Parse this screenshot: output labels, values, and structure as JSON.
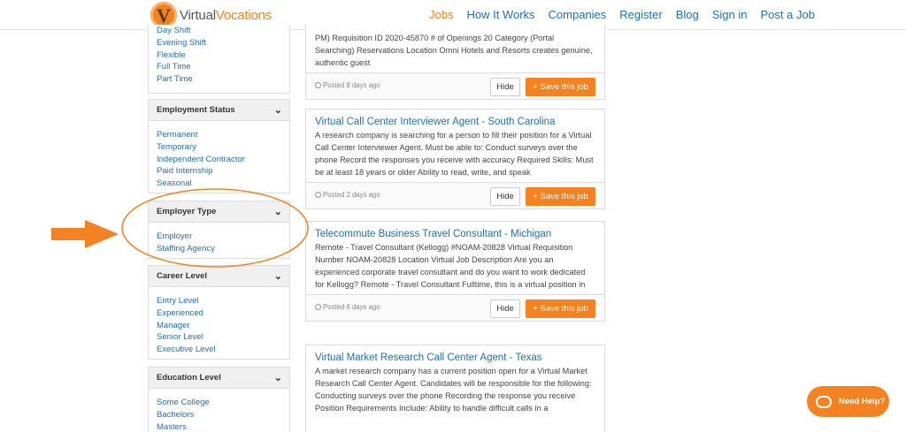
{
  "header": {
    "logo": {
      "mark": "V",
      "word1": "Virtual",
      "word2": "Vocations"
    },
    "nav": [
      "Jobs",
      "How It Works",
      "Companies",
      "Register",
      "Blog",
      "Sign in",
      "Post a Job"
    ],
    "active_nav": "Jobs"
  },
  "sidebar": {
    "schedule_items": [
      "Day Shift",
      "Evening Shift",
      "Flexible",
      "Full Time",
      "Part Time"
    ],
    "employment_status": {
      "title": "Employment Status",
      "items": [
        "Permanent",
        "Temporary",
        "Independent Contractor",
        "Paid Internship",
        "Seasonal"
      ]
    },
    "employer_type": {
      "title": "Employer Type",
      "items": [
        "Employer",
        "Staffing Agency"
      ]
    },
    "career_level": {
      "title": "Career Level",
      "items": [
        "Entry Level",
        "Experienced",
        "Manager",
        "Senior Level",
        "Executive Level"
      ]
    },
    "education_level": {
      "title": "Education Level",
      "items": [
        "Some College",
        "Bachelors",
        "Masters"
      ]
    }
  },
  "jobs": [
    {
      "title": "",
      "desc": "PM) Requisition ID 2020-45870 # of Openings 20 Category (Portal Searching) Reservations Location Omni Hotels and Resorts creates genuine, authentic guest",
      "posted": "Posted 8 days ago"
    },
    {
      "title": "Virtual Call Center Interviewer Agent - South Carolina",
      "desc": "A research company is searching for a person to fill their position for a Virtual Call Center Interviewer Agent. Must be able to: Conduct surveys over the phone Record the responses you receive with accuracy Required Skills: Must be at least 18 years or older Ability to read, write, and speak",
      "posted": "Posted 2 days ago"
    },
    {
      "title": "Telecommute Business Travel Consultant - Michigan",
      "desc": "Remote - Travel Consultant (Kellogg) #NOAM-20828 Virtual Requisition Number NOAM-20828 Location Virtual Job Description Are you an experienced corporate travel consultant and do you want to work dedicated for Kellogg? Remote - Travel Consultant Fulltime, this is a virtual position in",
      "posted": "Posted 6 days ago"
    },
    {
      "title": "Virtual Market Research Call Center Agent - Texas",
      "desc": "A market research company has a current position open for a Virtual Market Research Call Center Agent. Candidates will be responsible for the following: Conducting surveys over the phone Recording the response you receive Position Requirements Include: Ability to handle difficult calls in a",
      "posted": ""
    }
  ],
  "buttons": {
    "hide": "Hide",
    "save": "+ Save this job"
  },
  "help": {
    "label": "Need Help?"
  },
  "colors": {
    "accent": "#f58220",
    "link": "#1f6fb5"
  }
}
